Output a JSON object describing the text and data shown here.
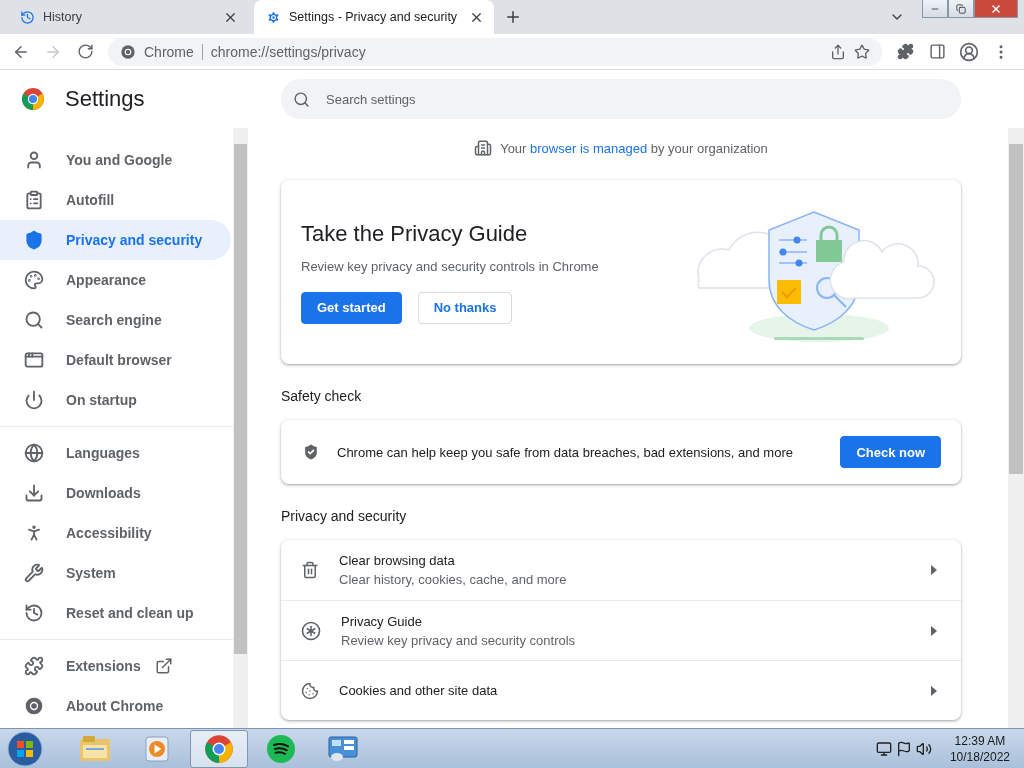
{
  "tabs": [
    {
      "label": "History",
      "kind": "history",
      "selected": false
    },
    {
      "label": "Settings - Privacy and security",
      "kind": "gear",
      "selected": true
    }
  ],
  "toolbar": {
    "forward_disabled": true,
    "site": "Chrome",
    "url": "chrome://settings/privacy"
  },
  "settings": {
    "title": "Settings",
    "search_placeholder": "Search settings"
  },
  "sidebar": {
    "groups": [
      [
        {
          "label": "You and Google",
          "kind": "person",
          "external": false,
          "selected": false
        },
        {
          "label": "Autofill",
          "kind": "clipboard",
          "external": false,
          "selected": false
        },
        {
          "label": "Privacy and security",
          "kind": "shield",
          "external": false,
          "selected": true
        },
        {
          "label": "Appearance",
          "kind": "palette",
          "external": false,
          "selected": false
        },
        {
          "label": "Search engine",
          "kind": "search",
          "external": false,
          "selected": false
        },
        {
          "label": "Default browser",
          "kind": "browser",
          "external": false,
          "selected": false
        },
        {
          "label": "On startup",
          "kind": "power",
          "external": false,
          "selected": false
        }
      ],
      [
        {
          "label": "Languages",
          "kind": "globe",
          "external": false,
          "selected": false
        },
        {
          "label": "Downloads",
          "kind": "download",
          "external": false,
          "selected": false
        },
        {
          "label": "Accessibility",
          "kind": "accessibility",
          "external": false,
          "selected": false
        },
        {
          "label": "System",
          "kind": "wrench",
          "external": false,
          "selected": false
        },
        {
          "label": "Reset and clean up",
          "kind": "reset",
          "external": false,
          "selected": false
        }
      ],
      [
        {
          "label": "Extensions",
          "kind": "puzzle",
          "external": true,
          "selected": false
        },
        {
          "label": "About Chrome",
          "kind": "chrome",
          "external": false,
          "selected": false
        }
      ]
    ]
  },
  "managed_notice": {
    "before": "Your",
    "link": "browser is managed",
    "after": "by your organization"
  },
  "privacy_guide_card": {
    "title": "Take the Privacy Guide",
    "description": "Review key privacy and security controls in Chrome",
    "buttons": [
      {
        "label": "Get started",
        "kind": "primary"
      },
      {
        "label": "No thanks",
        "kind": "secondary"
      }
    ]
  },
  "safety_check": {
    "heading": "Safety check",
    "text": "Chrome can help keep you safe from data breaches, bad extensions, and more",
    "button": "Check now"
  },
  "privacy_section": {
    "heading": "Privacy and security",
    "rows": [
      {
        "title": "Clear browsing data",
        "subtitle": "Clear history, cookies, cache, and more",
        "kind": "trash"
      },
      {
        "title": "Privacy Guide",
        "subtitle": "Review key privacy and security controls",
        "kind": "asterisk"
      },
      {
        "title": "Cookies and other site data",
        "kind": "cookie"
      }
    ]
  },
  "taskbar": {
    "apps": [
      {
        "kind": "explorer",
        "selected": false
      },
      {
        "kind": "media",
        "selected": false
      },
      {
        "kind": "chrome",
        "selected": true
      },
      {
        "kind": "spotify",
        "selected": false
      },
      {
        "kind": "control",
        "selected": false
      }
    ],
    "time": "12:39 AM",
    "date": "10/18/2022"
  }
}
